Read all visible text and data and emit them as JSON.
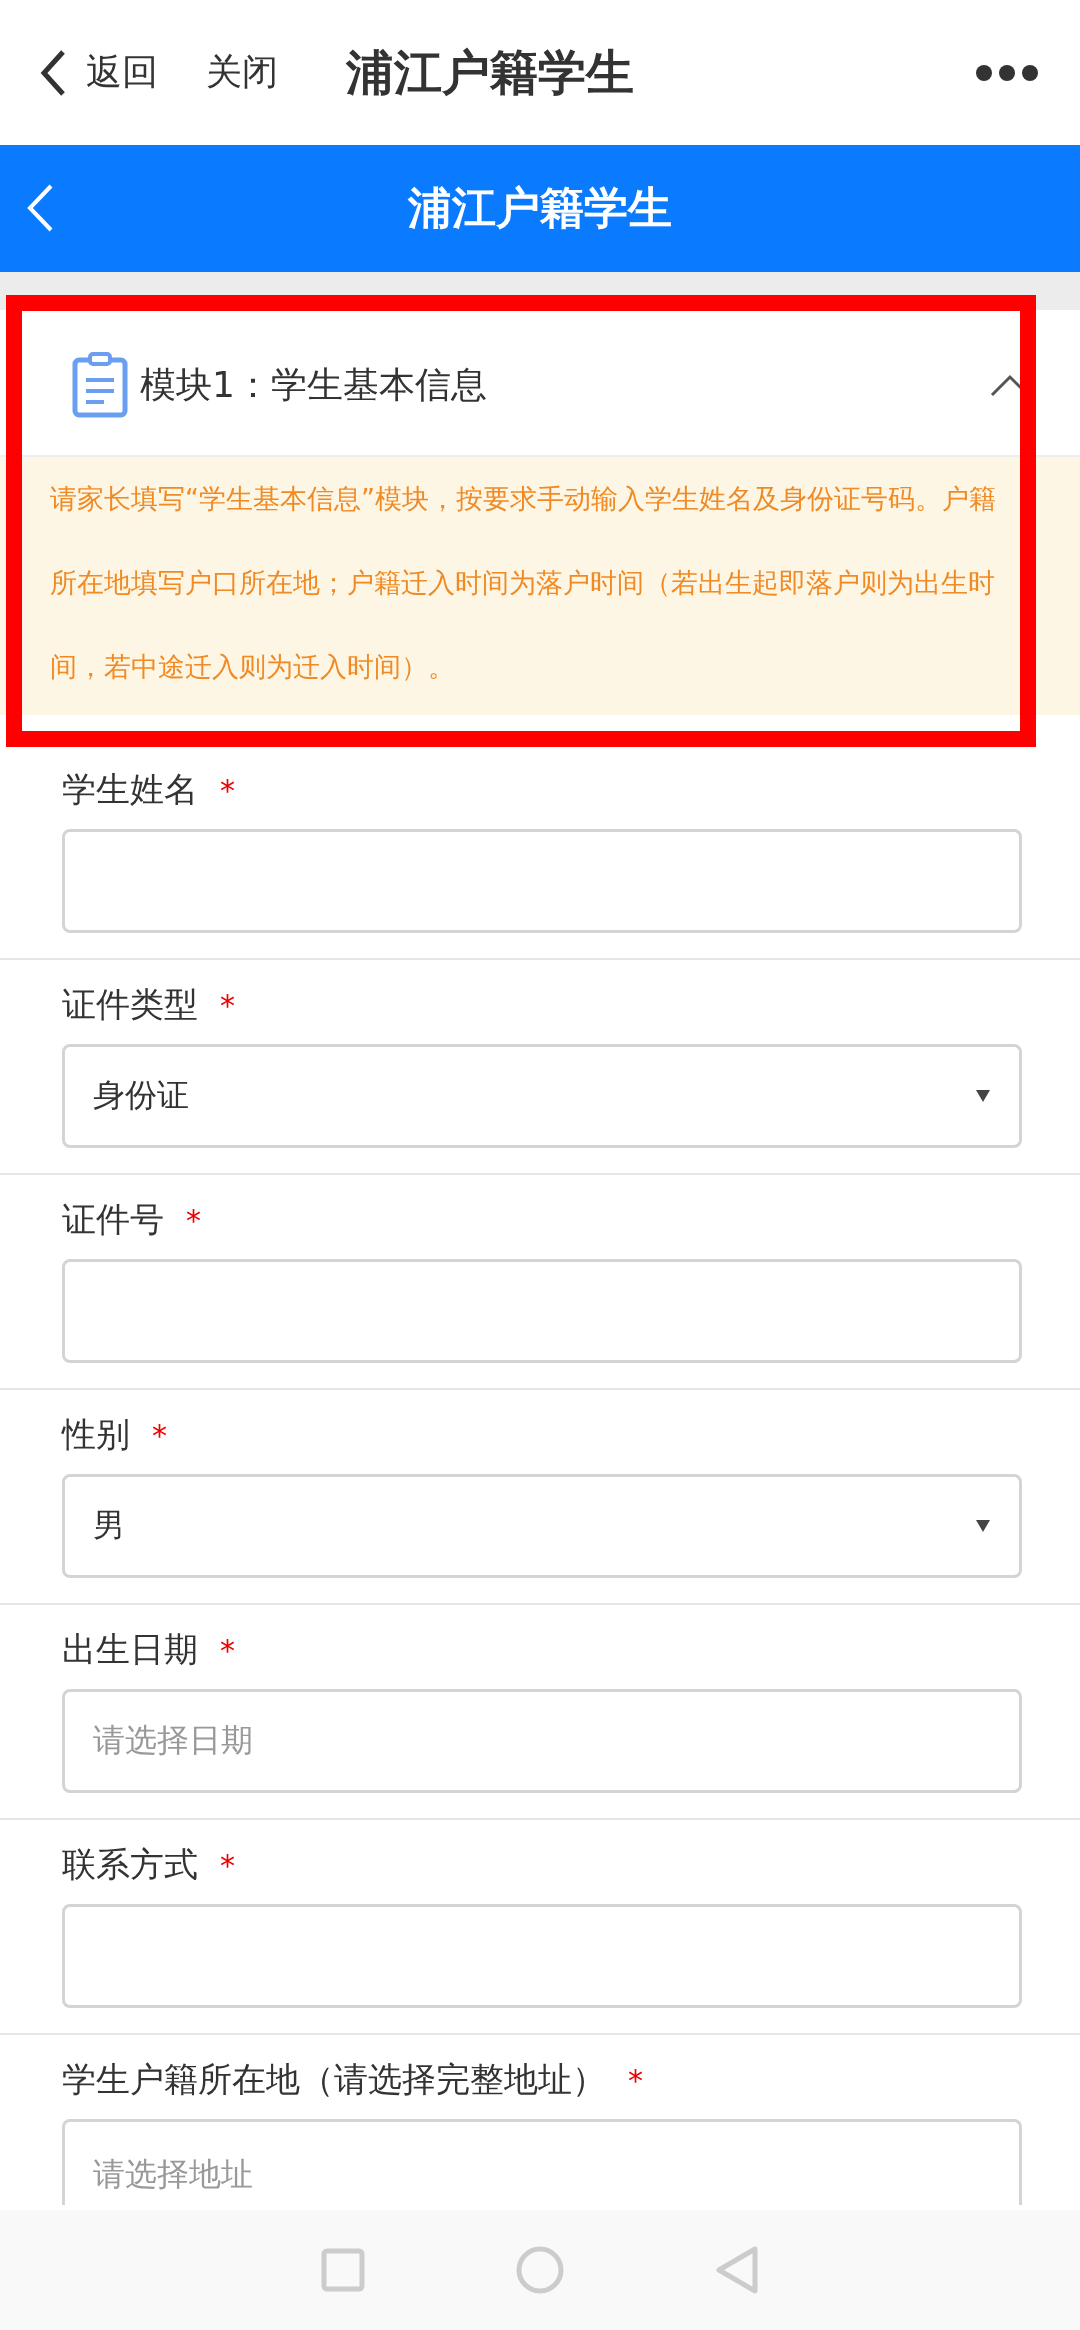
{
  "top_bar": {
    "back": "返回",
    "close": "关闭",
    "title": "浦江户籍学生"
  },
  "header": {
    "title": "浦江户籍学生"
  },
  "module": {
    "title": "模块1：学生基本信息",
    "expanded": true,
    "highlighted": true,
    "notice": "请家长填写“学生基本信息”模块，按要求手动输入学生姓名及身份证号码。户籍所在地填写户口所在地；户籍迁入时间为落户时间（若出生起即落户则为出生时间，若中途迁入则为迁入时间）。"
  },
  "fields": [
    {
      "label": "学生姓名",
      "required_mark": "*",
      "kind": "text"
    },
    {
      "label": "证件类型",
      "required_mark": "*",
      "kind": "select",
      "value": "身份证"
    },
    {
      "label": "证件号",
      "required_mark": "*",
      "kind": "text"
    },
    {
      "label": "性别",
      "required_mark": "*",
      "kind": "select",
      "value": "男"
    },
    {
      "label": "出生日期",
      "required_mark": "*",
      "kind": "date",
      "placeholder": "请选择日期"
    },
    {
      "label": "联系方式",
      "required_mark": "*",
      "kind": "text"
    },
    {
      "label": "学生户籍所在地（请选择完整地址）",
      "required_mark": "*",
      "kind": "address",
      "placeholder": "请选择地址"
    }
  ]
}
